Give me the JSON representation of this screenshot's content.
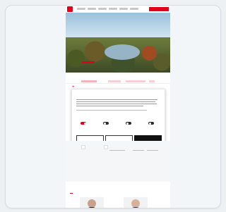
{
  "header": {
    "nav": [
      "",
      "",
      "",
      "",
      "",
      "",
      ""
    ],
    "top_button": ""
  },
  "hero": {
    "title": "",
    "subtitle": ""
  },
  "tabs": [
    "",
    "",
    ""
  ],
  "consent": {
    "title": "",
    "brand": "",
    "toggles": [
      {
        "label": "",
        "on": true
      },
      {
        "label": "",
        "on": false
      },
      {
        "label": "",
        "on": false
      },
      {
        "label": "",
        "on": false
      }
    ],
    "details_link": "",
    "buttons": [
      "",
      "",
      ""
    ]
  },
  "area": {
    "tags": [
      "",
      ""
    ],
    "cols": [
      {
        "head": "",
        "lines": [
          "",
          "",
          ""
        ]
      },
      {
        "head": "",
        "lines": [
          "",
          "",
          ""
        ]
      },
      {
        "head": "",
        "lines": [
          "",
          "",
          ""
        ]
      }
    ]
  },
  "section": {
    "title": ""
  },
  "colors": {
    "brand_red": "#e2001a",
    "dark": "#111111"
  }
}
